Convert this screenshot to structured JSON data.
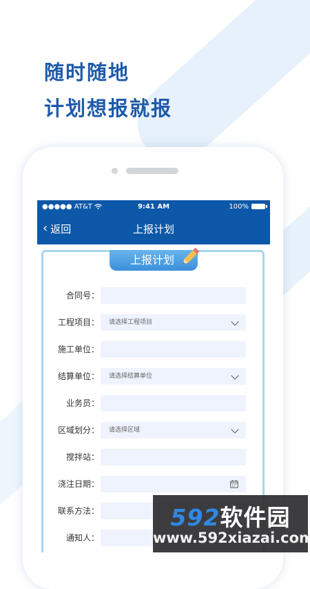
{
  "headline": {
    "line1": "随时随地",
    "line2": "计划想报就报"
  },
  "statusbar": {
    "carrier": "●●●●● AT&T",
    "time": "9:41 AM",
    "battery": "100%"
  },
  "navbar": {
    "back_label": "返回",
    "title": "上报计划"
  },
  "card": {
    "banner": "上报计划"
  },
  "form": {
    "fields": [
      {
        "label": "合同号：",
        "placeholder": ""
      },
      {
        "label": "工程项目：",
        "placeholder": "请选择工程项目"
      },
      {
        "label": "施工单位：",
        "placeholder": ""
      },
      {
        "label": "结算单位：",
        "placeholder": "请选择结算单位"
      },
      {
        "label": "业务员：",
        "placeholder": ""
      },
      {
        "label": "区域划分：",
        "placeholder": "请选择区域"
      },
      {
        "label": "搅拌站：",
        "placeholder": ""
      },
      {
        "label": "浇注日期：",
        "placeholder": ""
      },
      {
        "label": "联系方法：",
        "placeholder": ""
      },
      {
        "label": "通知人：",
        "placeholder": ""
      }
    ]
  },
  "watermark": {
    "num": "592",
    "cn": "软件园",
    "url": "www.592xiazai.com"
  },
  "colors": {
    "primary": "#0d58a8",
    "accent": "#3b8fdb",
    "field_bg": "#eef3fd"
  },
  "icons": [
    "wifi-icon",
    "battery-icon",
    "back-chevron-icon",
    "pencil-icon",
    "chevron-down-icon",
    "calendar-icon"
  ]
}
